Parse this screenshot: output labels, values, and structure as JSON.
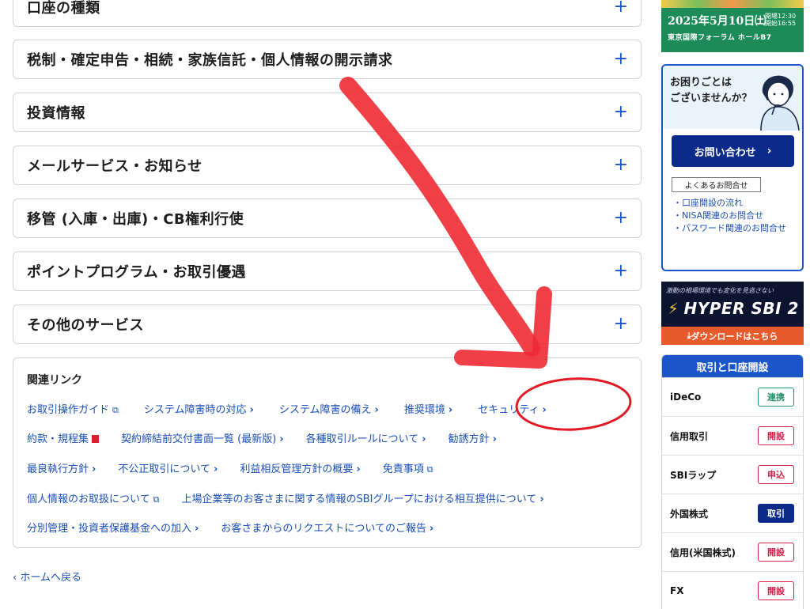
{
  "accordion": [
    {
      "title": "口座の種類"
    },
    {
      "title": "税制・確定申告・相続・家族信託・個人情報の開示請求"
    },
    {
      "title": "投資情報"
    },
    {
      "title": "メールサービス・お知らせ"
    },
    {
      "title": "移管 (入庫・出庫)・CB権利行使"
    },
    {
      "title": "ポイントプログラム・お取引優遇"
    },
    {
      "title": "その他のサービス"
    }
  ],
  "plus": "+",
  "related": {
    "title": "関連リンク",
    "rows": [
      [
        "お取引操作ガイド",
        "システム障害時の対応",
        "システム障害の備え",
        "推奨環境",
        "セキュリティ"
      ],
      [
        "約款・規程集",
        "契約締結前交付書面一覧 (最新版)",
        "各種取引ルールについて",
        "勧誘方針"
      ],
      [
        "最良執行方針",
        "不公正取引について",
        "利益相反管理方針の概要",
        "免責事項"
      ],
      [
        "個人情報のお取扱について",
        "上場企業等のお客さまに関する情報のSBIグループにおける相互提供について"
      ],
      [
        "分別管理・投資者保護基金への加入",
        "お客さまからのリクエストについてのご報告"
      ]
    ]
  },
  "back_label": "ホームへ戻る",
  "event_banner": {
    "date": "2025年5月10日㈯",
    "time_line1": "開場12:30",
    "time_line2": "開始16:55",
    "venue": "東京国際フォーラム ホールB7"
  },
  "help": {
    "question_line1": "お困りごとは",
    "question_line2": "ございませんか？",
    "contact_button": "お問い合わせ",
    "faq_tag": "よくあるお問合せ",
    "links": [
      "・口座開設の流れ",
      "・NISA関連のお問合せ",
      "・パスワード関連のお問合せ"
    ]
  },
  "hyper_banner": {
    "tagline": "激動の相場環境でも変化を見逃さない",
    "name": "HYPER SBI 2",
    "download": "ダウンロードはこちら"
  },
  "trade": {
    "title": "取引と口座開設",
    "items": [
      {
        "name": "iDeCo",
        "action": "連携"
      },
      {
        "name": "信用取引",
        "action": "開設"
      },
      {
        "name": "SBIラップ",
        "action": "申込"
      },
      {
        "name": "外国株式",
        "action": "取引"
      },
      {
        "name": "信用(米国株式)",
        "action": "開設"
      },
      {
        "name": "FX",
        "action": "開設"
      }
    ]
  },
  "colors": {
    "link": "#1a4fb8",
    "accent_blue": "#1a56c9",
    "navy": "#0b2a8a",
    "annotation_red": "#ee2a33"
  }
}
